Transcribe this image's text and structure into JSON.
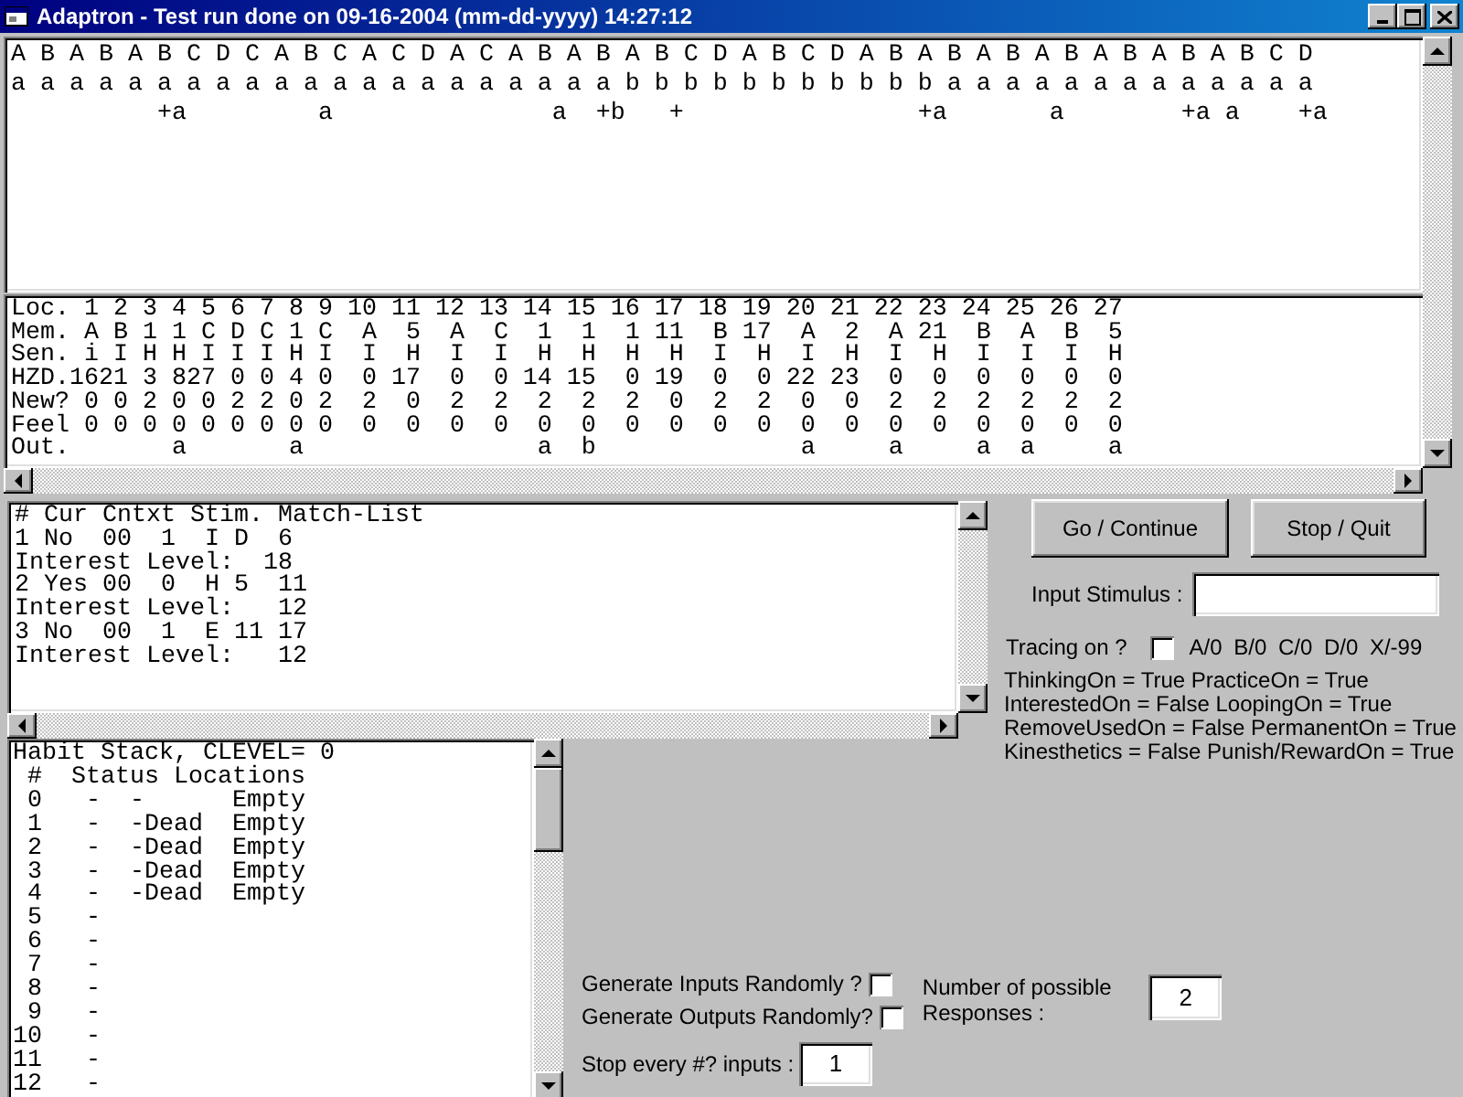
{
  "window": {
    "title": "Adaptron - Test run done on 09-16-2004 (mm-dd-yyyy) 14:27:12"
  },
  "memory_trace": {
    "sequence_lines": [
      "A B A B A B C D C A B C A C D A C A B A B A B C D A B C D A B A B A B A B A B A B A B C D",
      "a a a a a a a a a a a a a a a a a a a a a b b b b b b b b b b b a a a a a a a a a a a a a",
      "          +a         a               a  +b   +                +a       a        +a a    +a"
    ],
    "table_lines": [
      "Loc. 1 2 3 4 5 6 7 8 9 10 11 12 13 14 15 16 17 18 19 20 21 22 23 24 25 26 27",
      "Mem. A B 1 1 C D C 1 C  A  5  A  C  1  1  1 11  B 17  A  2  A 21  B  A  B  5",
      "Sen. i I H H I I I H I  I  H  I  I  H  H  H  H  I  H  I  H  I  H  I  I  I  H",
      "HZD.1621 3 827 0 0 4 0  0 17  0  0 14 15  0 19  0  0 22 23  0  0  0  0  0  0",
      "New? 0 0 2 0 0 2 2 0 2  2  0  2  2  2  2  2  0  2  2  0  0  2  2  2  2  2  2",
      "Feel 0 0 0 0 0 0 0 0 0  0  0  0  0  0  0  0  0  0  0  0  0  0  0  0  0  0  0",
      "Out.       a       a                a  b              a     a     a  a     a"
    ]
  },
  "match_list": {
    "lines": [
      "# Cur Cntxt Stim. Match-List",
      "1 No  00  1  I D  6",
      "Interest Level:  18",
      "2 Yes 00  0  H 5  11",
      "Interest Level:   12",
      "3 No  00  1  E 11 17",
      "Interest Level:   12"
    ]
  },
  "habit_stack": {
    "lines": [
      "Habit Stack, CLEVEL= 0",
      " #  Status Locations",
      " 0   -  -      Empty",
      " 1   -  -Dead  Empty",
      " 2   -  -Dead  Empty",
      " 3   -  -Dead  Empty",
      " 4   -  -Dead  Empty",
      " 5   -",
      " 6   -",
      " 7   -",
      " 8   -",
      " 9   -",
      "10   -",
      "11   -",
      "12   -"
    ]
  },
  "buttons": [
    {
      "label": "Go / Continue"
    },
    {
      "label": "Stop / Quit"
    }
  ],
  "input_stimulus": {
    "label": "Input Stimulus :"
  },
  "tracing": {
    "label": "Tracing on ?",
    "checked": false,
    "legend": "A/0 B/0 C/0 D/0 X/-99"
  },
  "settings_lines": [
    "ThinkingOn = True PracticeOn = True",
    "InterestedOn = False LoopingOn = True",
    "RemoveUsedOn = False PermanentOn = True",
    "Kinesthetics = False Punish/RewardOn = True"
  ],
  "random_options": [
    {
      "label": "Generate Inputs Randomly ?",
      "checked": false
    },
    {
      "label": "Generate Outputs Randomly?",
      "checked": false
    }
  ],
  "stop_every": {
    "label": "Stop every #? inputs :",
    "value": "1"
  },
  "responses": {
    "label": "Number of possible Responses :",
    "value": "2"
  }
}
